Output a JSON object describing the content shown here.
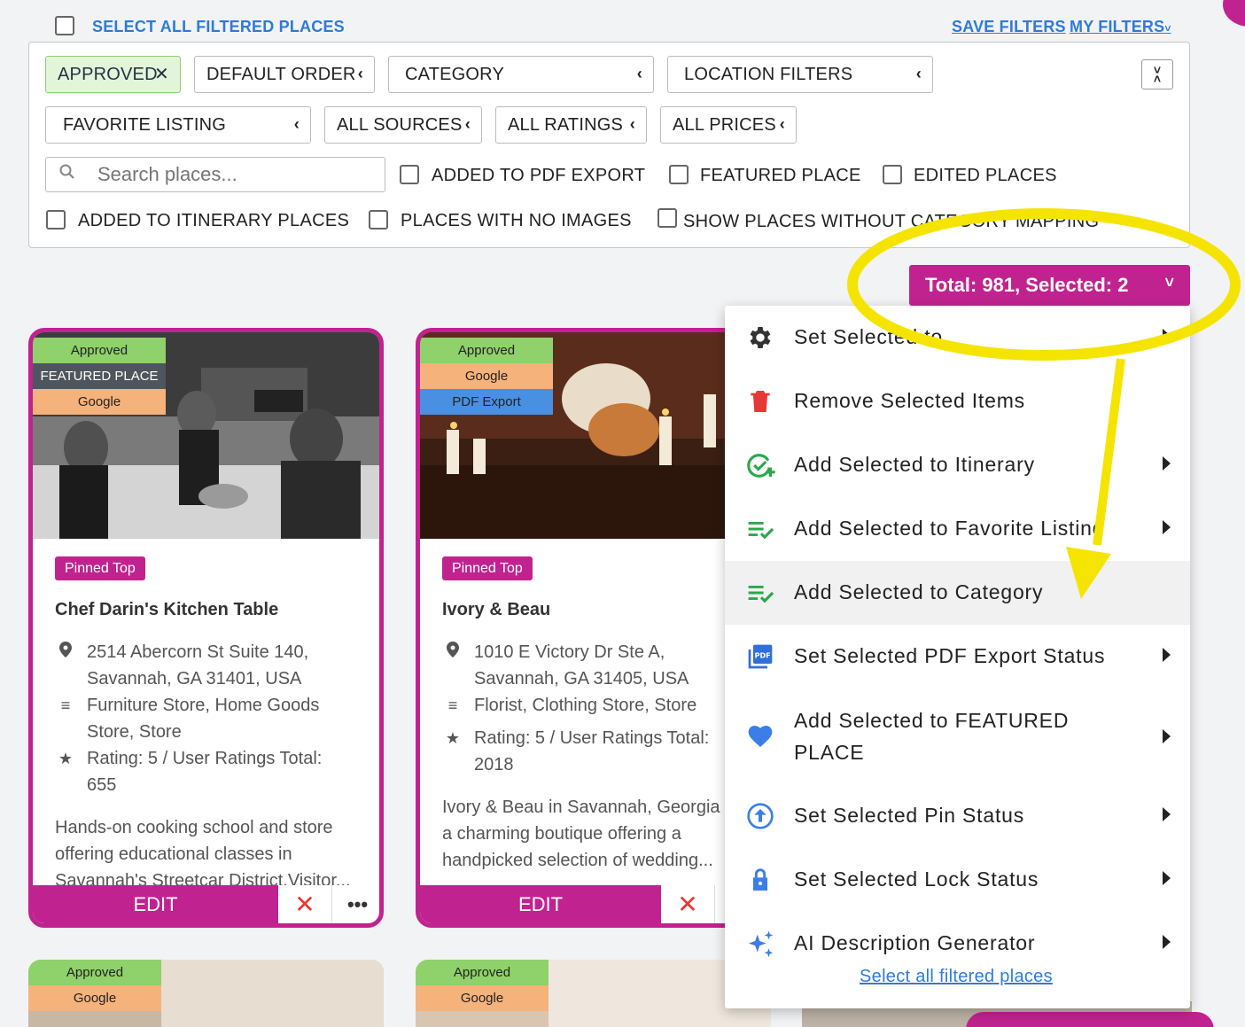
{
  "top_bar": {
    "select_all_label": "SELECT ALL FILTERED PLACES",
    "save_filters": "SAVE FILTERS",
    "my_filters": "MY FILTERS"
  },
  "filters": {
    "chips_row1": [
      "APPROVED",
      "DEFAULT ORDER",
      "CATEGORY",
      "LOCATION FILTERS"
    ],
    "chips_row2": [
      "FAVORITE LISTING",
      "ALL SOURCES",
      "ALL RATINGS",
      "ALL PRICES"
    ],
    "search_placeholder": "Search places...",
    "checkboxes_row1": [
      "ADDED TO PDF EXPORT",
      "FEATURED PLACE",
      "EDITED PLACES"
    ],
    "checkboxes_row2": [
      "ADDED TO ITINERARY PLACES",
      "PLACES WITH NO IMAGES",
      "SHOW PLACES WITHOUT CATEGORY MAPPING"
    ]
  },
  "total_button": "Total: 981, Selected: 2",
  "cards": [
    {
      "badges": [
        "Approved",
        "FEATURED PLACE",
        "Google"
      ],
      "pin": "Pinned Top",
      "title": "Chef Darin's Kitchen Table",
      "address": "2514 Abercorn St Suite 140, Savannah, GA 31401, USA",
      "categories": "Furniture Store, Home Goods Store, Store",
      "rating": "Rating: 5 / User Ratings Total: 655",
      "description": "Hands-on cooking school and store offering educational classes in Savannah's Streetcar District.Visitor...",
      "edit": "EDIT"
    },
    {
      "badges": [
        "Approved",
        "Google",
        "PDF Export"
      ],
      "pin": "Pinned Top",
      "title": "Ivory & Beau",
      "address": "1010 E Victory Dr Ste A, Savannah, GA 31405, USA",
      "categories": "Florist, Clothing Store, Store",
      "rating": "Rating: 5 / User Ratings Total: 2018",
      "description": "Ivory & Beau in Savannah, Georgia a charming boutique offering a handpicked selection of wedding...",
      "edit": "EDIT"
    }
  ],
  "bottom_cards": [
    {
      "badges": [
        "Approved",
        "Google"
      ]
    },
    {
      "badges": [
        "Approved",
        "Google"
      ]
    }
  ],
  "menu": {
    "items": [
      {
        "label": "Set Selected to",
        "icon": "gear-icon",
        "submenu": true
      },
      {
        "label": "Remove Selected Items",
        "icon": "trash-icon",
        "submenu": false
      },
      {
        "label": "Add Selected to Itinerary",
        "icon": "check-circle-add-icon",
        "submenu": true
      },
      {
        "label": "Add Selected to Favorite Listing",
        "icon": "playlist-check-icon",
        "submenu": true
      },
      {
        "label": "Add Selected to Category",
        "icon": "playlist-check-icon",
        "submenu": false
      },
      {
        "label": "Set Selected PDF Export Status",
        "icon": "pdf-icon",
        "submenu": true
      },
      {
        "label": "Add Selected to FEATURED PLACE",
        "icon": "heart-icon",
        "submenu": true
      },
      {
        "label": "Set Selected Pin Status",
        "icon": "arrow-up-circle-icon",
        "submenu": true
      },
      {
        "label": "Set Selected Lock Status",
        "icon": "lock-icon",
        "submenu": true
      },
      {
        "label": "AI Description Generator",
        "icon": "sparkle-icon",
        "submenu": true
      }
    ],
    "footer_link": "Select all filtered places"
  },
  "colors": {
    "brand": "#c0238f",
    "link": "#2f7bd8",
    "highlight_annotation": "#f5e400",
    "approved_badge": "#8fd16a",
    "google_badge": "#f5b27a",
    "featured_badge": "#4f555c",
    "pdf_badge": "#4a90e2"
  }
}
